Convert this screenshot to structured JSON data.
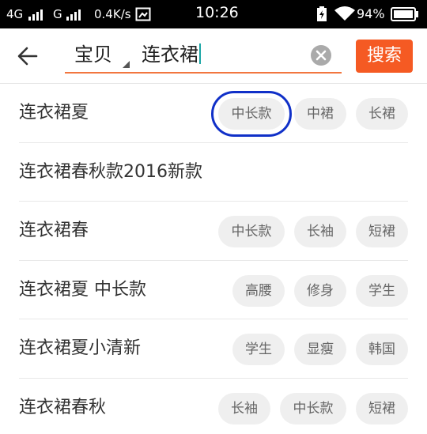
{
  "status_bar": {
    "network_4g": "4G",
    "network_g": "G",
    "speed": "0.4K/s",
    "time": "10:26",
    "battery_percent": "94%"
  },
  "header": {
    "scope_label": "宝贝",
    "query": "连衣裙",
    "search_button": "搜索",
    "accent_color": "#f55a23",
    "icons": [
      "back-arrow-icon",
      "dropdown-triangle-icon",
      "clear-icon"
    ]
  },
  "suggestions": [
    {
      "label": "连衣裙夏",
      "tags": [
        "中长款",
        "中裙",
        "长裙"
      ]
    },
    {
      "label": "连衣裙春秋款2016新款",
      "tags": []
    },
    {
      "label": "连衣裙春",
      "tags": [
        "中长款",
        "长袖",
        "短裙"
      ]
    },
    {
      "label": "连衣裙夏 中长款",
      "tags": [
        "高腰",
        "修身",
        "学生"
      ]
    },
    {
      "label": "连衣裙夏小清新",
      "tags": [
        "学生",
        "显瘦",
        "韩国"
      ]
    },
    {
      "label": "连衣裙春秋",
      "tags": [
        "长袖",
        "中长款",
        "短裙"
      ]
    }
  ]
}
